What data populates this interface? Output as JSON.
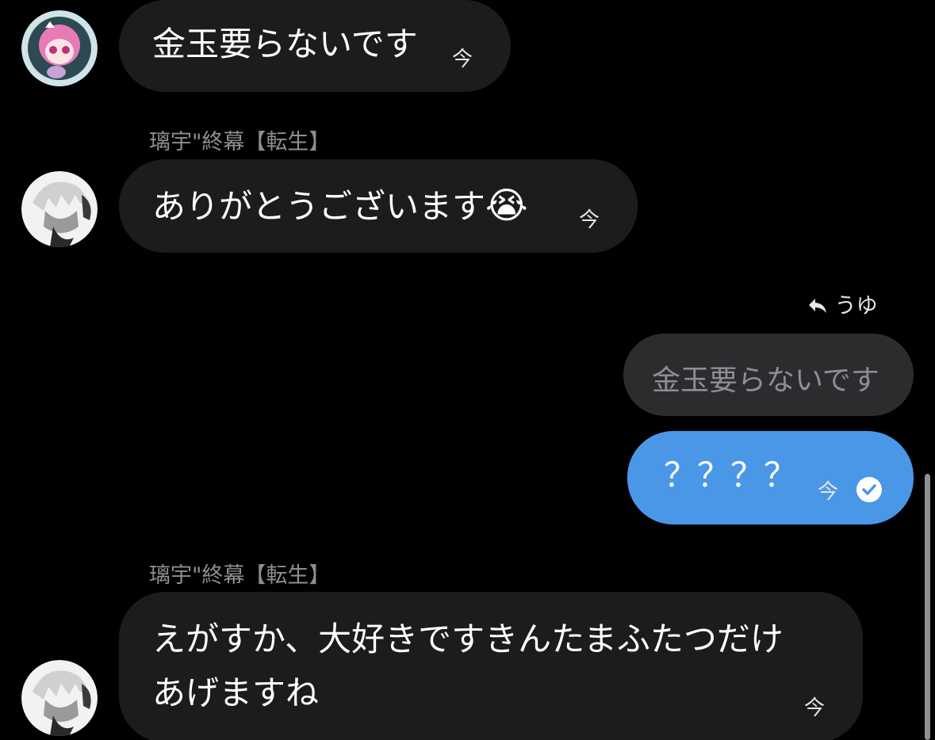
{
  "messages": [
    {
      "id": "m1",
      "text": "金玉要らないです",
      "time": "今"
    },
    {
      "id": "m2",
      "sender": "璃宇\"終幕【転生】",
      "text": "ありがとうございます",
      "emoji": "😭",
      "time": "今"
    },
    {
      "id": "m3",
      "reply_to_name": "うゆ",
      "quoted_text": "金玉要らないです",
      "text": "？？？？",
      "time": "今",
      "status": "read"
    },
    {
      "id": "m4",
      "sender": "璃宇\"終幕【転生】",
      "text_line1": "えがすか、大好きですきんたまふたつだけ",
      "text_line2": "あげますね",
      "time": "今"
    }
  ],
  "colors": {
    "background": "#000000",
    "incoming_bubble": "#1c1c1e",
    "quoted_bubble": "#2c2c2e",
    "outgoing_bubble": "#4a97e8",
    "sender_name": "#8e8e93"
  }
}
